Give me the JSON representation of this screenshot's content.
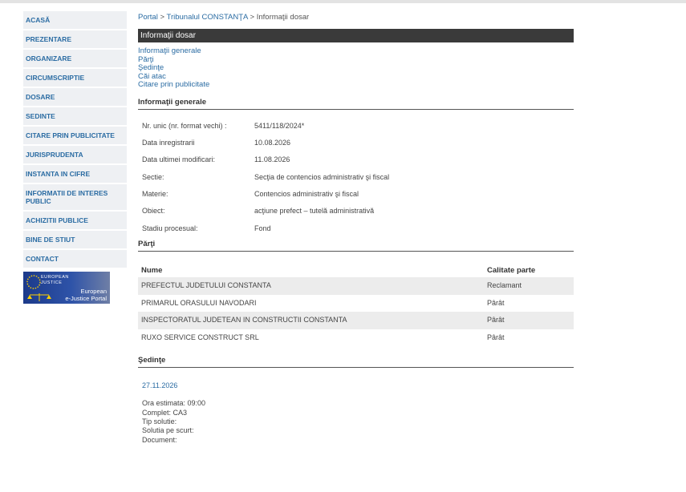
{
  "sidebar": {
    "items": [
      {
        "label": "ACASĂ"
      },
      {
        "label": "PREZENTARE"
      },
      {
        "label": "ORGANIZARE"
      },
      {
        "label": "CIRCUMSCRIPTIE"
      },
      {
        "label": "DOSARE"
      },
      {
        "label": "SEDINTE"
      },
      {
        "label": "CITARE PRIN PUBLICITATE"
      },
      {
        "label": "JURISPRUDENTA"
      },
      {
        "label": "INSTANTA IN CIFRE"
      },
      {
        "label": "INFORMATII DE INTERES PUBLIC"
      },
      {
        "label": "ACHIZITII PUBLICE"
      },
      {
        "label": "BINE DE STIUT"
      },
      {
        "label": "CONTACT"
      }
    ],
    "banner": {
      "line1": "EUROPEAN",
      "line2": "JUSTICE",
      "line3": "European",
      "line4": "e-Justice Portal"
    }
  },
  "breadcrumb": {
    "portal": "Portal",
    "sep": ">",
    "court": "Tribunalul CONSTANŢA",
    "current": "Informaţii dosar"
  },
  "page_title": "Informaţii dosar",
  "quick_links": [
    "Informaţii generale",
    "Părţi",
    "Şedinţe",
    "Căi atac",
    "Citare prin publicitate"
  ],
  "general": {
    "title": "Informaţii generale",
    "rows": [
      {
        "label": "Nr. unic (nr. format vechi) :",
        "value": "5411/118/2024*"
      },
      {
        "label": "Data inregistrarii",
        "value": "10.08.2026"
      },
      {
        "label": "Data ultimei modificari:",
        "value": "11.08.2026"
      },
      {
        "label": "Sectie:",
        "value": "Secţia de contencios administrativ şi fiscal"
      },
      {
        "label": "Materie:",
        "value": "Contencios administrativ şi fiscal"
      },
      {
        "label": "Obiect:",
        "value": "acţiune prefect – tutelă administrativă"
      },
      {
        "label": "Stadiu procesual:",
        "value": "Fond"
      }
    ]
  },
  "parti": {
    "title": "Părţi",
    "col_name": "Nume",
    "col_role": "Calitate parte",
    "rows": [
      {
        "name": "PREFECTUL JUDETULUI CONSTANTA",
        "role": "Reclamant"
      },
      {
        "name": "PRIMARUL ORASULUI NAVODARI",
        "role": "Pârât"
      },
      {
        "name": "INSPECTORATUL JUDETEAN IN CONSTRUCTII CONSTANTA",
        "role": "Pârât"
      },
      {
        "name": "RUXO SERVICE CONSTRUCT SRL",
        "role": "Pârât"
      }
    ]
  },
  "sedinte": {
    "title": "Şedinţe",
    "date": "27.11.2026",
    "details": [
      "Ora estimata: 09:00",
      "Complet: CA3",
      "Tip solutie:",
      "Solutia pe scurt:",
      "Document:"
    ]
  }
}
